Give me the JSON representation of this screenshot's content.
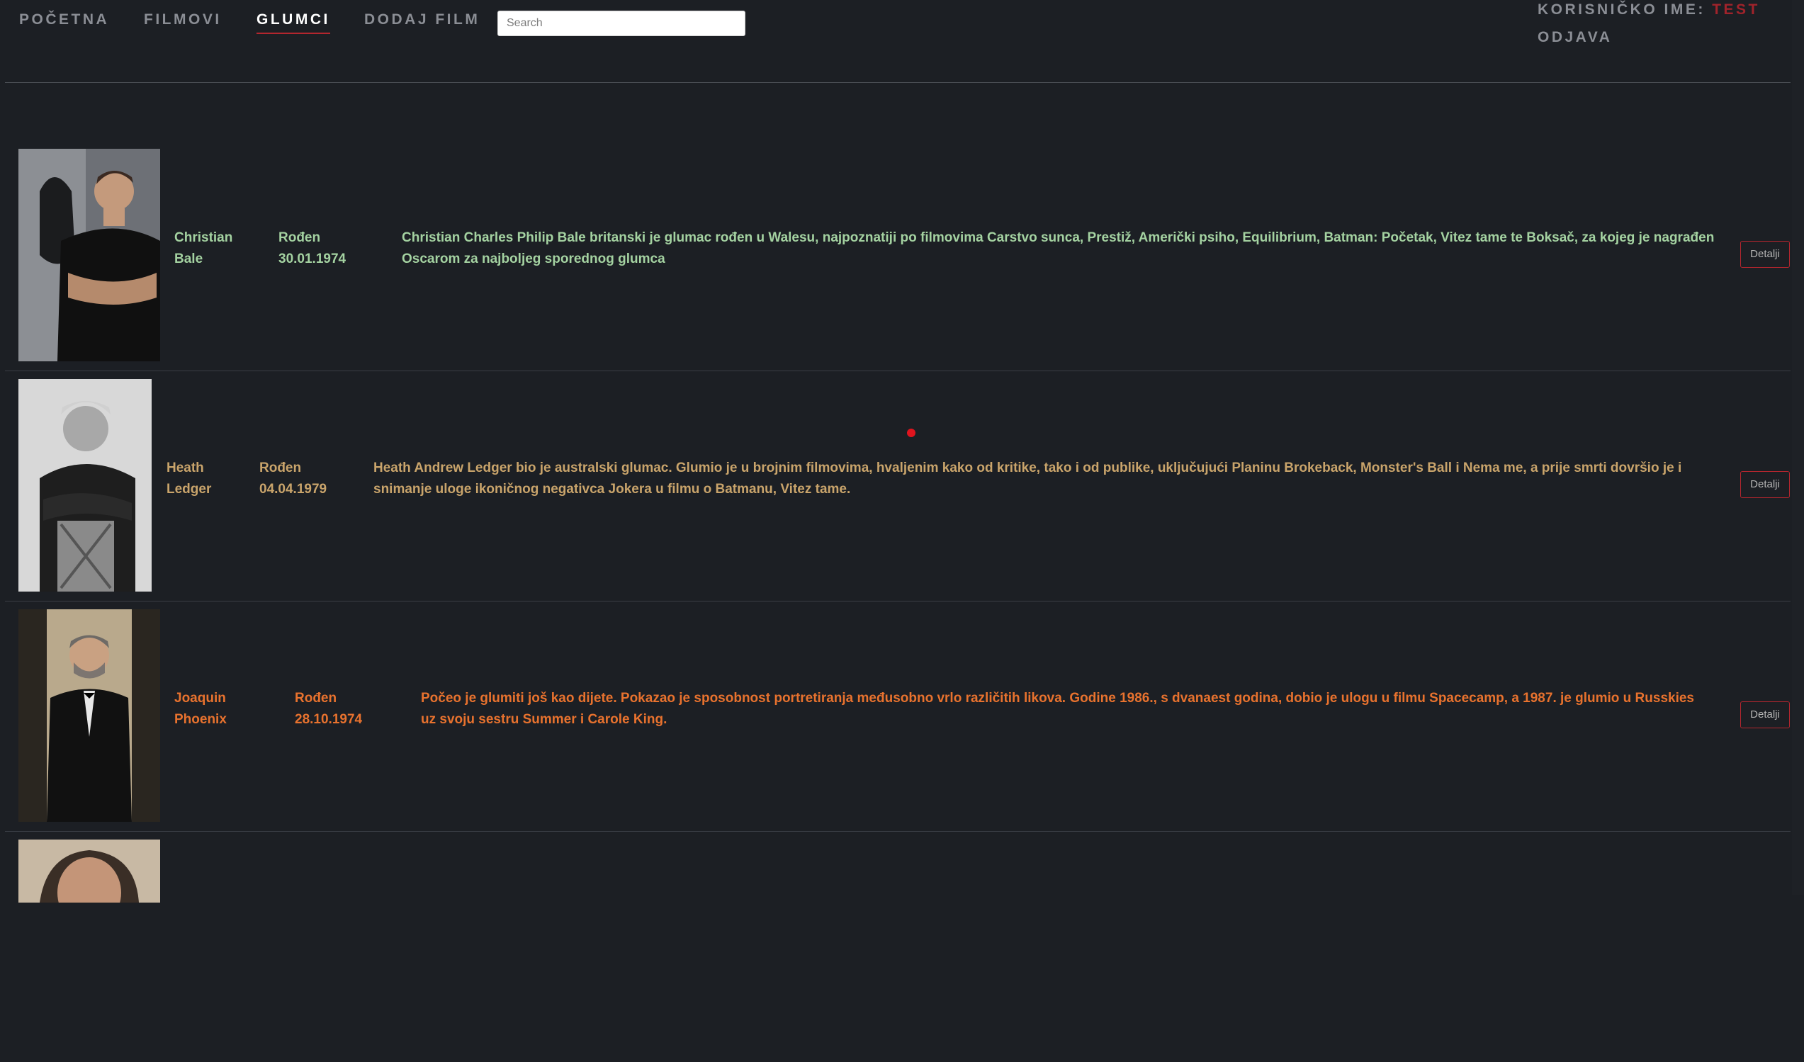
{
  "nav": {
    "items": [
      {
        "label": "POČETNA",
        "active": false
      },
      {
        "label": "FILMOVI",
        "active": false
      },
      {
        "label": "GLUMCI",
        "active": true
      },
      {
        "label": "DODAJ FILM",
        "active": false
      }
    ],
    "search_placeholder": "Search",
    "user_label": "KORISNIČKO IME:",
    "user_name": "TEST",
    "logout": "ODJAVA"
  },
  "actors": [
    {
      "first_name": "Christian",
      "last_name": "Bale",
      "born_label": "Rođen",
      "born_date": "30.01.1974",
      "bio": "Christian Charles Philip Bale britanski je glumac rođen u Walesu, najpoznatiji po filmovima Carstvo sunca, Prestiž, Američki psiho, Equilibrium, Batman: Početak, Vitez tame te Boksač, za kojeg je nagrađen Oscarom za najboljeg sporednog glumca",
      "button": "Detalji",
      "text_color": "#a4d2a1"
    },
    {
      "first_name": "Heath",
      "last_name": "Ledger",
      "born_label": "Rođen",
      "born_date": "04.04.1979",
      "bio": "Heath Andrew Ledger bio je australski glumac. Glumio je u brojnim filmovima, hvaljenim kako od kritike, tako i od publike, uključujući Planinu Brokeback, Monster's Ball i Nema me, a prije smrti dovršio je i snimanje uloge ikoničnog negativca Jokera u filmu o Batmanu, Vitez tame.",
      "button": "Detalji",
      "text_color": "#c9a46b"
    },
    {
      "first_name": "Joaquin",
      "last_name": "Phoenix",
      "born_label": "Rođen",
      "born_date": "28.10.1974",
      "bio": "Počeo je glumiti još kao dijete. Pokazao je sposobnost portretiranja međusobno vrlo različitih likova. Godine 1986., s dvanaest godina, dobio je ulogu u filmu Spacecamp, a 1987. je glumio u Russkies uz svoju sestru Summer i Carole King.",
      "button": "Detalji",
      "text_color": "#e8722e"
    }
  ],
  "colors": {
    "background": "#1c1f24",
    "accent_red": "#b3262e",
    "nav_text": "#8b8e95"
  }
}
